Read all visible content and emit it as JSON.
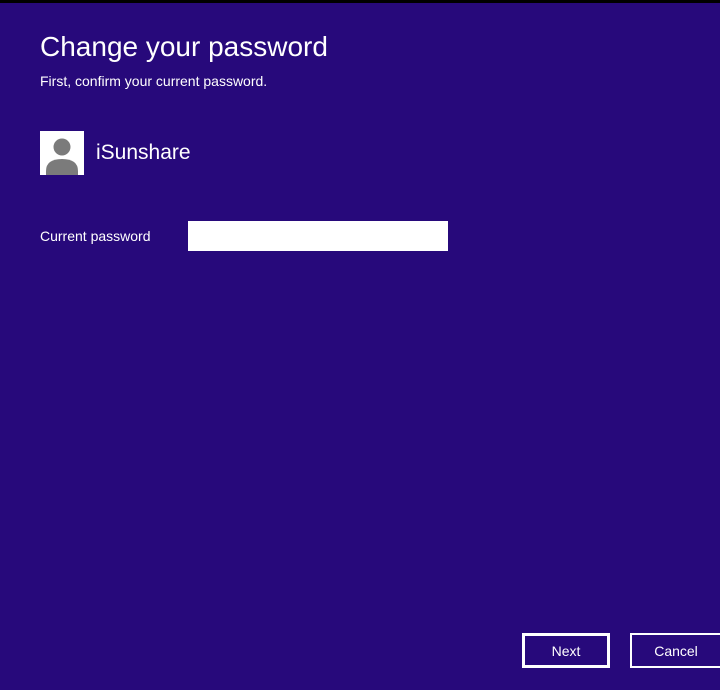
{
  "header": {
    "title": "Change your password",
    "subtitle": "First, confirm your current password."
  },
  "user": {
    "name": "iSunshare"
  },
  "form": {
    "current_password_label": "Current password",
    "current_password_value": ""
  },
  "buttons": {
    "next": "Next",
    "cancel": "Cancel"
  }
}
